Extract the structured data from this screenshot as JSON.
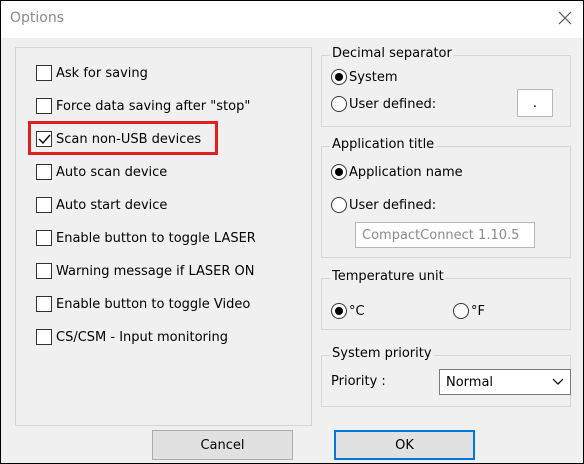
{
  "window": {
    "title": "Options"
  },
  "left_checkboxes": [
    {
      "label": "Ask for saving",
      "checked": false
    },
    {
      "label": "Force data saving after \"stop\"",
      "checked": false
    },
    {
      "label": "Scan non-USB devices",
      "checked": true
    },
    {
      "label": "Auto scan device",
      "checked": false
    },
    {
      "label": "Auto start device",
      "checked": false
    },
    {
      "label": "Enable button to toggle LASER",
      "checked": false
    },
    {
      "label": "Warning message if LASER ON",
      "checked": false
    },
    {
      "label": "Enable button to toggle Video",
      "checked": false
    },
    {
      "label": "CS/CSM - Input monitoring",
      "checked": false
    }
  ],
  "decimal_separator": {
    "title": "Decimal separator",
    "option_system": "System",
    "option_user": "User defined:",
    "selected": "System",
    "user_value": "."
  },
  "application_title": {
    "title": "Application title",
    "option_app": "Application name",
    "option_user": "User defined:",
    "selected": "Application name",
    "user_value": "CompactConnect 1.10.5"
  },
  "temperature_unit": {
    "title": "Temperature unit",
    "option_c": "°C",
    "option_f": "°F",
    "selected": "°C"
  },
  "system_priority": {
    "title": "System priority",
    "label": "Priority :",
    "value": "Normal"
  },
  "buttons": {
    "cancel": "Cancel",
    "ok": "OK"
  },
  "colors": {
    "highlight": "#e0201e",
    "default_button_border": "#0078d7"
  }
}
